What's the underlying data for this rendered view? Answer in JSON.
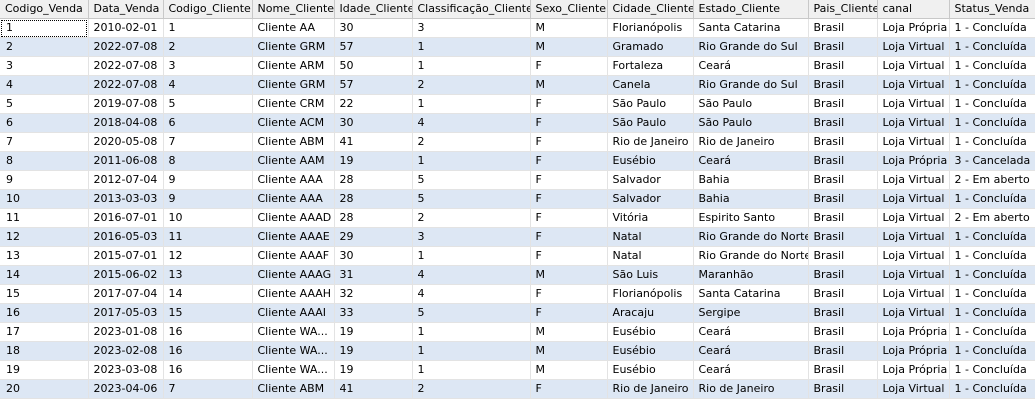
{
  "columns": [
    "Codigo_Venda",
    "Data_Venda",
    "Codigo_Cliente",
    "Nome_Cliente",
    "Idade_Cliente",
    "Classificação_Cliente",
    "Sexo_Cliente",
    "Cidade_Cliente",
    "Estado_Cliente",
    "Pais_Cliente",
    "canal",
    "Status_Venda"
  ],
  "rows": [
    [
      "1",
      "2010-02-01",
      "1",
      "Cliente AA",
      "30",
      "3",
      "M",
      "Florianópolis",
      "Santa Catarina",
      "Brasil",
      "Loja Própria",
      "1 - Concluída"
    ],
    [
      "2",
      "2022-07-08",
      "2",
      "Cliente GRM",
      "57",
      "1",
      "M",
      "Gramado",
      "Rio Grande do Sul",
      "Brasil",
      "Loja Virtual",
      "1 - Concluída"
    ],
    [
      "3",
      "2022-07-08",
      "3",
      "Cliente ARM",
      "50",
      "1",
      "F",
      "Fortaleza",
      "Ceará",
      "Brasil",
      "Loja Virtual",
      "1 - Concluída"
    ],
    [
      "4",
      "2022-07-08",
      "4",
      "Cliente GRM",
      "57",
      "2",
      "M",
      "Canela",
      "Rio Grande do Sul",
      "Brasil",
      "Loja Virtual",
      "1 - Concluída"
    ],
    [
      "5",
      "2019-07-08",
      "5",
      "Cliente CRM",
      "22",
      "1",
      "F",
      "São Paulo",
      "São Paulo",
      "Brasil",
      "Loja Virtual",
      "1 - Concluída"
    ],
    [
      "6",
      "2018-04-08",
      "6",
      "Cliente ACM",
      "30",
      "4",
      "F",
      "São Paulo",
      "São Paulo",
      "Brasil",
      "Loja Virtual",
      "1 - Concluída"
    ],
    [
      "7",
      "2020-05-08",
      "7",
      "Cliente ABM",
      "41",
      "2",
      "F",
      "Rio de Janeiro",
      "Rio de Janeiro",
      "Brasil",
      "Loja Virtual",
      "1 - Concluída"
    ],
    [
      "8",
      "2011-06-08",
      "8",
      "Cliente AAM",
      "19",
      "1",
      "F",
      "Eusébio",
      "Ceará",
      "Brasil",
      "Loja Própria",
      "3 - Cancelada"
    ],
    [
      "9",
      "2012-07-04",
      "9",
      "Cliente AAA",
      "28",
      "5",
      "F",
      "Salvador",
      "Bahia",
      "Brasil",
      "Loja Virtual",
      "2 - Em aberto"
    ],
    [
      "10",
      "2013-03-03",
      "9",
      "Cliente AAA",
      "28",
      "5",
      "F",
      "Salvador",
      "Bahia",
      "Brasil",
      "Loja Virtual",
      "1 - Concluída"
    ],
    [
      "11",
      "2016-07-01",
      "10",
      "Cliente AAAD",
      "28",
      "2",
      "F",
      "Vitória",
      "Espirito Santo",
      "Brasil",
      "Loja Virtual",
      "2 - Em aberto"
    ],
    [
      "12",
      "2016-05-03",
      "11",
      "Cliente AAAE",
      "29",
      "3",
      "F",
      "Natal",
      "Rio Grande do Norte",
      "Brasil",
      "Loja Virtual",
      "1 - Concluída"
    ],
    [
      "13",
      "2015-07-01",
      "12",
      "Cliente AAAF",
      "30",
      "1",
      "F",
      "Natal",
      "Rio Grande do Norte",
      "Brasil",
      "Loja Virtual",
      "1 - Concluída"
    ],
    [
      "14",
      "2015-06-02",
      "13",
      "Cliente AAAG",
      "31",
      "4",
      "M",
      "São Luis",
      "Maranhão",
      "Brasil",
      "Loja Virtual",
      "1 - Concluída"
    ],
    [
      "15",
      "2017-07-04",
      "14",
      "Cliente AAAH",
      "32",
      "4",
      "F",
      "Florianópolis",
      "Santa Catarina",
      "Brasil",
      "Loja Virtual",
      "1 - Concluída"
    ],
    [
      "16",
      "2017-05-03",
      "15",
      "Cliente AAAI",
      "33",
      "5",
      "F",
      "Aracaju",
      "Sergipe",
      "Brasil",
      "Loja Virtual",
      "1 - Concluída"
    ],
    [
      "17",
      "2023-01-08",
      "16",
      "Cliente WA...",
      "19",
      "1",
      "M",
      "Eusébio",
      "Ceará",
      "Brasil",
      "Loja Própria",
      "1 - Concluída"
    ],
    [
      "18",
      "2023-02-08",
      "16",
      "Cliente WA...",
      "19",
      "1",
      "M",
      "Eusébio",
      "Ceará",
      "Brasil",
      "Loja Própria",
      "1 - Concluída"
    ],
    [
      "19",
      "2023-03-08",
      "16",
      "Cliente WA...",
      "19",
      "1",
      "M",
      "Eusébio",
      "Ceará",
      "Brasil",
      "Loja Própria",
      "1 - Concluída"
    ],
    [
      "20",
      "2023-04-06",
      "7",
      "Cliente ABM",
      "41",
      "2",
      "F",
      "Rio de Janeiro",
      "Rio de Janeiro",
      "Brasil",
      "Loja Virtual",
      "1 - Concluída"
    ]
  ],
  "selected_cell": "rows.0.0",
  "colors": {
    "header_bg": "#f0f0f0",
    "alt_row_bg": "#dde7f4",
    "row_bg": "#ffffff",
    "grid_line": "#e3e3e3"
  }
}
